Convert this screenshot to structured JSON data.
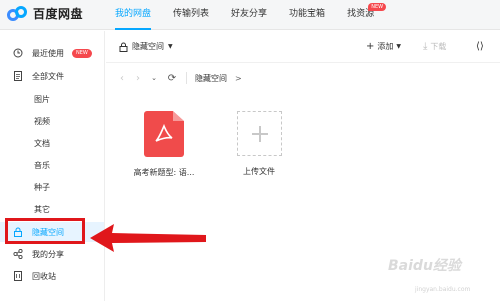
{
  "app": {
    "name": "百度网盘",
    "accent": "#06a7ff",
    "highlight": "#e0171b"
  },
  "nav": {
    "tabs": [
      {
        "label": "我的网盘",
        "active": true
      },
      {
        "label": "传输列表"
      },
      {
        "label": "好友分享"
      },
      {
        "label": "功能宝箱"
      },
      {
        "label": "找资源",
        "badge": "NEW"
      }
    ]
  },
  "sidebar": {
    "items": [
      {
        "label": "最近使用",
        "icon": "clock-icon",
        "badge": "NEW"
      },
      {
        "label": "全部文件",
        "icon": "document-icon"
      },
      {
        "label": "图片"
      },
      {
        "label": "视频"
      },
      {
        "label": "文档"
      },
      {
        "label": "音乐"
      },
      {
        "label": "种子"
      },
      {
        "label": "其它"
      },
      {
        "label": "隐藏空间",
        "icon": "lock-icon",
        "selected": true
      },
      {
        "label": "我的分享",
        "icon": "share-icon"
      },
      {
        "label": "回收站",
        "icon": "trash-icon"
      }
    ]
  },
  "toolbar": {
    "space_label": "隐藏空间",
    "add_label": "添加",
    "download_label": "下载"
  },
  "breadcrumb": {
    "current": "隐藏空间"
  },
  "files": [
    {
      "name": "高考新题型: 语...",
      "icon": "pdf-icon"
    },
    {
      "name": "上传文件",
      "icon": "plus-icon"
    }
  ],
  "watermark": {
    "text": "Baidu经验",
    "sub": "jingyan.baidu.com"
  }
}
